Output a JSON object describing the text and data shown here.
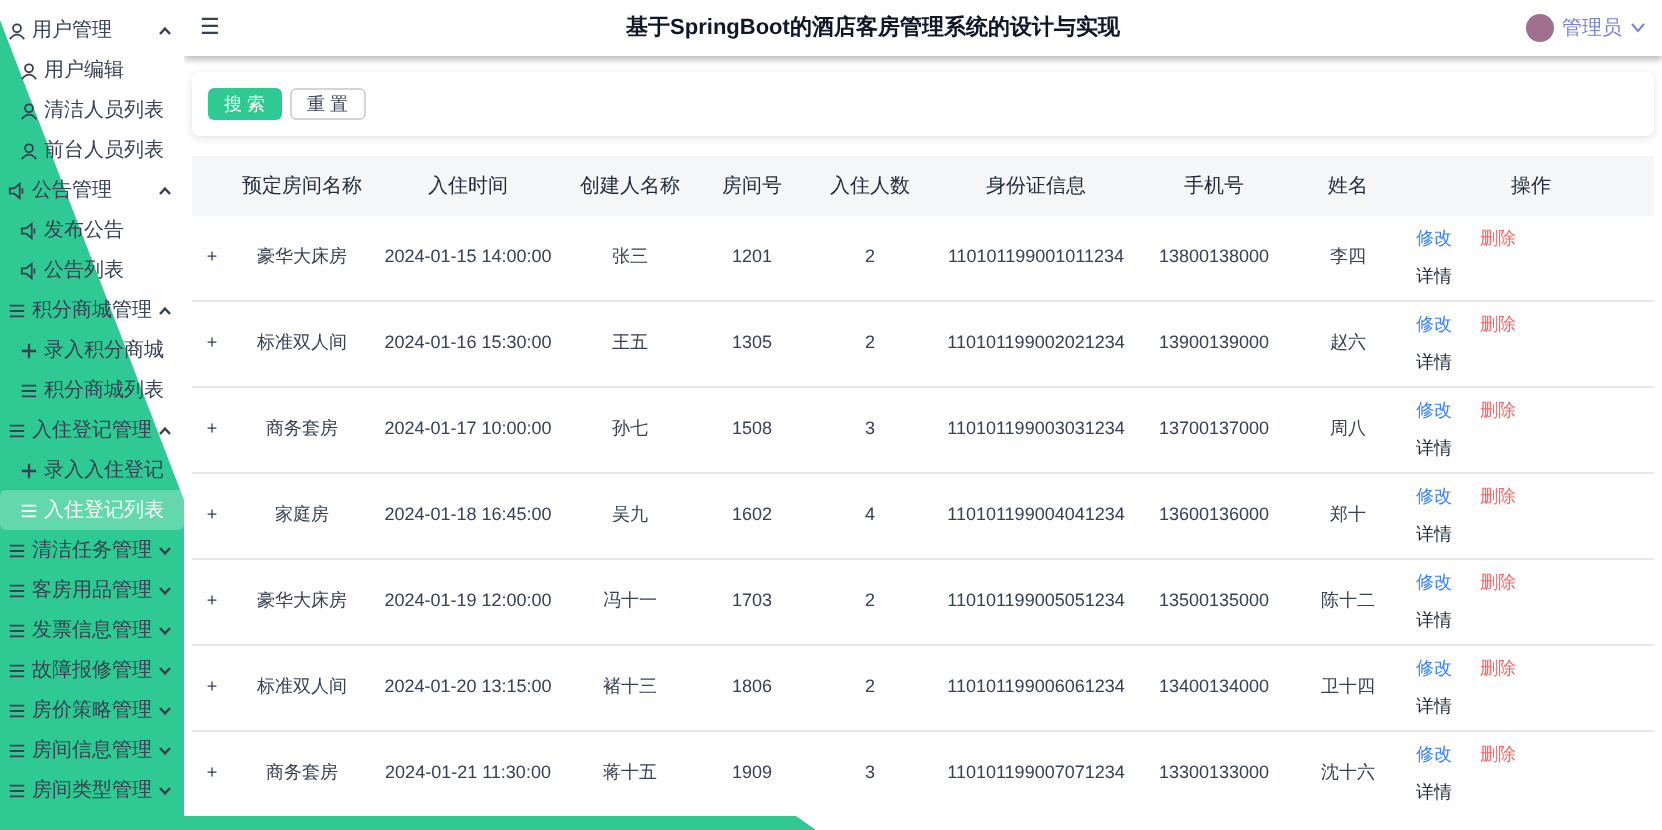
{
  "sidebar": {
    "items": [
      {
        "label": "用户管理",
        "kind": "user",
        "expanded": true,
        "children": [
          {
            "label": "用户编辑",
            "kind": "user",
            "selected": false
          },
          {
            "label": "清洁人员列表",
            "kind": "user",
            "selected": false
          },
          {
            "label": "前台人员列表",
            "kind": "user",
            "selected": false
          }
        ]
      },
      {
        "label": "公告管理",
        "kind": "speaker",
        "expanded": true,
        "children": [
          {
            "label": "发布公告",
            "kind": "speaker",
            "selected": false
          },
          {
            "label": "公告列表",
            "kind": "speaker",
            "selected": false
          }
        ]
      },
      {
        "label": "积分商城管理",
        "kind": "list",
        "expanded": true,
        "children": [
          {
            "label": "录入积分商城",
            "kind": "plus",
            "selected": false
          },
          {
            "label": "积分商城列表",
            "kind": "list",
            "selected": false
          }
        ]
      },
      {
        "label": "入住登记管理",
        "kind": "list",
        "expanded": true,
        "children": [
          {
            "label": "录入入住登记",
            "kind": "plus",
            "selected": false
          },
          {
            "label": "入住登记列表",
            "kind": "list",
            "selected": true
          }
        ]
      },
      {
        "label": "清洁任务管理",
        "kind": "list",
        "expanded": false
      },
      {
        "label": "客房用品管理",
        "kind": "list",
        "expanded": false
      },
      {
        "label": "发票信息管理",
        "kind": "list",
        "expanded": false
      },
      {
        "label": "故障报修管理",
        "kind": "list",
        "expanded": false
      },
      {
        "label": "房价策略管理",
        "kind": "list",
        "expanded": false
      },
      {
        "label": "房间信息管理",
        "kind": "list",
        "expanded": false
      },
      {
        "label": "房间类型管理",
        "kind": "list",
        "expanded": false
      }
    ]
  },
  "header": {
    "menu_icon": "☰",
    "title": "基于SpringBoot的酒店客房管理系统的设计与实现",
    "user": "管理员"
  },
  "search": {
    "buttons": [
      {
        "label": "搜 索",
        "kind": "primary"
      },
      {
        "label": "重 置",
        "kind": "default"
      }
    ]
  },
  "table": {
    "columns": [
      "预定房间名称",
      "入住时间",
      "创建人名称",
      "房间号",
      "入住人数",
      "身份证信息",
      "手机号",
      "姓名",
      "操作"
    ],
    "rows": [
      {
        "expand": "+",
        "cells": [
          "豪华大床房",
          "2024-01-15 14:00:00",
          "张三",
          "1201",
          "2",
          "110101199001011234",
          "13800138000",
          "李四"
        ],
        "actions": {
          "edit": "修改",
          "delete": "删除",
          "detail": "详情"
        }
      },
      {
        "expand": "+",
        "cells": [
          "标准双人间",
          "2024-01-16 15:30:00",
          "王五",
          "1305",
          "2",
          "110101199002021234",
          "13900139000",
          "赵六"
        ],
        "actions": {
          "edit": "修改",
          "delete": "删除",
          "detail": "详情"
        }
      },
      {
        "expand": "+",
        "cells": [
          "商务套房",
          "2024-01-17 10:00:00",
          "孙七",
          "1508",
          "3",
          "110101199003031234",
          "13700137000",
          "周八"
        ],
        "actions": {
          "edit": "修改",
          "delete": "删除",
          "detail": "详情"
        }
      },
      {
        "expand": "+",
        "cells": [
          "家庭房",
          "2024-01-18 16:45:00",
          "吴九",
          "1602",
          "4",
          "110101199004041234",
          "13600136000",
          "郑十"
        ],
        "actions": {
          "edit": "修改",
          "delete": "删除",
          "detail": "详情"
        }
      },
      {
        "expand": "+",
        "cells": [
          "豪华大床房",
          "2024-01-19 12:00:00",
          "冯十一",
          "1703",
          "2",
          "110101199005051234",
          "13500135000",
          "陈十二"
        ],
        "actions": {
          "edit": "修改",
          "delete": "删除",
          "detail": "详情"
        }
      },
      {
        "expand": "+",
        "cells": [
          "标准双人间",
          "2024-01-20 13:15:00",
          "褚十三",
          "1806",
          "2",
          "110101199006061234",
          "13400134000",
          "卫十四"
        ],
        "actions": {
          "edit": "修改",
          "delete": "删除",
          "detail": "详情"
        }
      },
      {
        "expand": "+",
        "cells": [
          "商务套房",
          "2024-01-21 11:30:00",
          "蒋十五",
          "1909",
          "3",
          "110101199007071234",
          "13300133000",
          "沈十六"
        ],
        "actions": {
          "edit": "修改",
          "delete": "删除",
          "detail": "详情"
        }
      }
    ]
  }
}
